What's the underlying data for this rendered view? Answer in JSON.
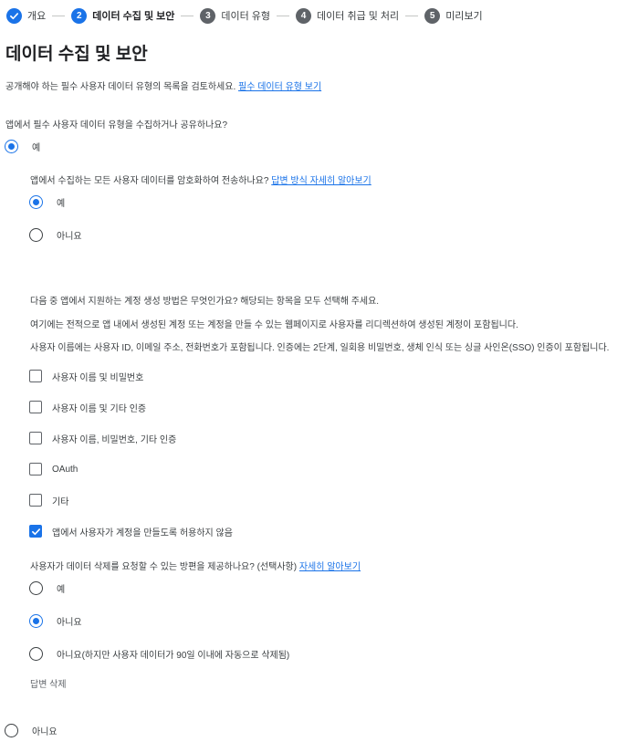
{
  "stepper": {
    "steps": [
      {
        "number": "",
        "label": "개요",
        "state": "done"
      },
      {
        "number": "2",
        "label": "데이터 수집 및 보안",
        "state": "active"
      },
      {
        "number": "3",
        "label": "데이터 유형",
        "state": "todo"
      },
      {
        "number": "4",
        "label": "데이터 취급 및 처리",
        "state": "todo"
      },
      {
        "number": "5",
        "label": "미리보기",
        "state": "todo"
      }
    ]
  },
  "page": {
    "title": "데이터 수집 및 보안",
    "intro_text": "공개해야 하는 필수 사용자 데이터 유형의 목록을 검토하세요.",
    "intro_link": "필수 데이터 유형 보기"
  },
  "q_collect": {
    "question": "앱에서 필수 사용자 데이터 유형을 수집하거나 공유하나요?",
    "yes": "예",
    "no": "아니요"
  },
  "q_encrypt": {
    "question": "앱에서 수집하는 모든 사용자 데이터를 암호화하여 전송하나요?",
    "link": "답변 방식 자세히 알아보기",
    "yes": "예",
    "no": "아니요"
  },
  "q_account": {
    "question": "다음 중 앱에서 지원하는 계정 생성 방법은 무엇인가요? 해당되는 항목을 모두 선택해 주세요.",
    "note1": "여기에는 전적으로 앱 내에서 생성된 계정 또는 계정을 만들 수 있는 웹페이지로 사용자를 리디렉션하여 생성된 계정이 포함됩니다.",
    "note2": "사용자 이름에는 사용자 ID, 이메일 주소, 전화번호가 포함됩니다. 인증에는 2단계, 일회용 비밀번호, 생체 인식 또는 싱글 사인온(SSO) 인증이 포함됩니다.",
    "options": [
      {
        "label": "사용자 이름 및 비밀번호",
        "checked": false
      },
      {
        "label": "사용자 이름 및 기타 인증",
        "checked": false
      },
      {
        "label": "사용자 이름, 비밀번호, 기타 인증",
        "checked": false
      },
      {
        "label": "OAuth",
        "checked": false
      },
      {
        "label": "기타",
        "checked": false
      },
      {
        "label": "앱에서 사용자가 계정을 만들도록 허용하지 않음",
        "checked": true
      }
    ]
  },
  "q_delete": {
    "question": "사용자가 데이터 삭제를 요청할 수 있는 방편을 제공하나요? (선택사항)",
    "link": "자세히 알아보기",
    "yes": "예",
    "no": "아니요",
    "auto": "아니요(하지만 사용자 데이터가 90일 이내에 자동으로 삭제됨)",
    "clear": "답변 삭제"
  },
  "colors": {
    "accent": "#1a73e8",
    "text": "#3c4043",
    "step_todo": "#5f6368"
  }
}
